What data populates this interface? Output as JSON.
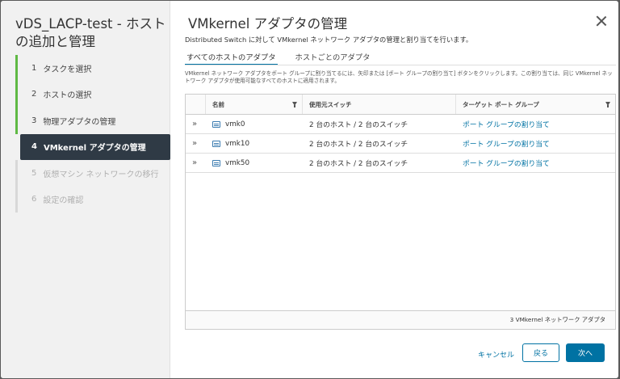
{
  "wizard": {
    "title": "vDS_LACP-test - ホストの追加と管理",
    "steps": [
      {
        "num": "1",
        "label": "タスクを選択",
        "state": "done"
      },
      {
        "num": "2",
        "label": "ホストの選択",
        "state": "done"
      },
      {
        "num": "3",
        "label": "物理アダプタの管理",
        "state": "done"
      },
      {
        "num": "4",
        "label": "VMkernel アダプタの管理",
        "state": "current"
      },
      {
        "num": "5",
        "label": "仮想マシン ネットワークの移行",
        "state": "pending"
      },
      {
        "num": "6",
        "label": "設定の確認",
        "state": "pending"
      }
    ]
  },
  "page": {
    "title": "VMkernel アダプタの管理",
    "subtitle": "Distributed Switch に対して VMkernel ネットワーク アダプタの管理と割り当てを行います。",
    "tabs": [
      "すべてのホストのアダプタ",
      "ホストごとのアダプタ"
    ],
    "active_tab": 0,
    "description": "VMkernel ネットワーク アダプタをポート グループに割り当てるには、矢印または [ポート グループの割り当て] ボタンをクリックします。この割り当ては、同じ VMkernel ネットワーク アダプタが使用可能なすべてのホストに適用されます。"
  },
  "grid": {
    "columns": {
      "name": "名前",
      "switch": "使用元スイッチ",
      "port_group": "ターゲット ポート グループ"
    },
    "rows": [
      {
        "expand": "»",
        "name": "vmk0",
        "switch": "2 台のホスト / 2 台のスイッチ",
        "port_group": "ポート グループの割り当て"
      },
      {
        "expand": "»",
        "name": "vmk10",
        "switch": "2 台のホスト / 2 台のスイッチ",
        "port_group": "ポート グループの割り当て"
      },
      {
        "expand": "»",
        "name": "vmk50",
        "switch": "2 台のホスト / 2 台のスイッチ",
        "port_group": "ポート グループの割り当て"
      }
    ],
    "footer": "3 VMkernel ネットワーク アダプタ"
  },
  "buttons": {
    "cancel": "キャンセル",
    "back": "戻る",
    "next": "次へ"
  },
  "colors": {
    "accent": "#0072a3",
    "step_done": "#5fb944",
    "step_current_bg": "#2f3a45"
  }
}
